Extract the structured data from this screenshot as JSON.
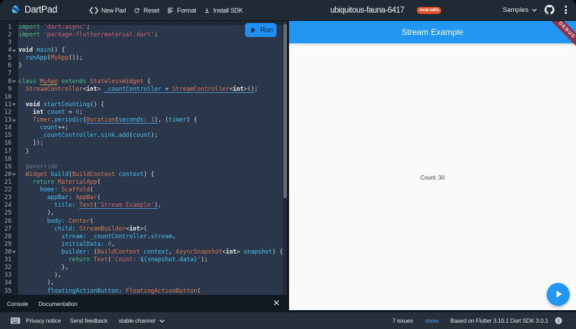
{
  "header": {
    "brand": "DartPad",
    "menu": [
      {
        "icon": "code-icon",
        "label": "New Pad"
      },
      {
        "icon": "refresh-icon",
        "label": "Reset"
      },
      {
        "icon": "format-icon",
        "label": "Format"
      },
      {
        "icon": "download-icon",
        "label": "Install SDK"
      }
    ],
    "pad_title": "ubiquitous-fauna-6417",
    "badge": "local edits",
    "samples": "Samples"
  },
  "editor": {
    "run_label": "Run",
    "fold_lines": [
      4,
      8,
      11,
      13,
      20,
      30
    ],
    "line_count": 35,
    "lines": [
      [
        [
          "k",
          "import"
        ],
        [
          "p",
          " "
        ],
        [
          "s",
          "'dart:async'"
        ],
        [
          "p",
          ";"
        ]
      ],
      [
        [
          "k",
          "import"
        ],
        [
          "p",
          " "
        ],
        [
          "s",
          "'package:flutter/material.dart'"
        ],
        [
          "p",
          ";"
        ]
      ],
      [],
      [
        [
          "b",
          "void"
        ],
        [
          "p",
          " "
        ],
        [
          "v",
          "main"
        ],
        [
          "p",
          "() {"
        ]
      ],
      [
        [
          "p",
          "  "
        ],
        [
          "v",
          "runApp"
        ],
        [
          "p",
          "("
        ],
        [
          "t",
          "MyApp"
        ],
        [
          "p",
          "());"
        ]
      ],
      [
        [
          "p",
          "}"
        ]
      ],
      [],
      [
        [
          "k",
          "class"
        ],
        [
          "p",
          " "
        ],
        [
          "t uk",
          "MyApp"
        ],
        [
          "p",
          " "
        ],
        [
          "k",
          "extends"
        ],
        [
          "p",
          " "
        ],
        [
          "t",
          "StatelessWidget"
        ],
        [
          "p",
          " {"
        ]
      ],
      [
        [
          "p",
          "  "
        ],
        [
          "t",
          "StreamController"
        ],
        [
          "p",
          "<"
        ],
        [
          "b",
          "int"
        ],
        [
          "p",
          "> "
        ],
        [
          "v ub",
          "_countController"
        ],
        [
          "p ub",
          " = "
        ],
        [
          "t ub",
          "StreamController"
        ],
        [
          "p ub",
          "<"
        ],
        [
          "b ub",
          "int"
        ],
        [
          "p ub",
          ">()"
        ],
        [
          "p",
          ";"
        ]
      ],
      [],
      [
        [
          "p",
          "  "
        ],
        [
          "b",
          "void"
        ],
        [
          "p",
          " "
        ],
        [
          "v",
          "startCounting"
        ],
        [
          "p",
          "() {"
        ]
      ],
      [
        [
          "p",
          "    "
        ],
        [
          "b",
          "int"
        ],
        [
          "p",
          " "
        ],
        [
          "v",
          "count"
        ],
        [
          "p",
          " = "
        ],
        [
          "n",
          "0"
        ],
        [
          "p",
          ";"
        ]
      ],
      [
        [
          "p",
          "    "
        ],
        [
          "t",
          "Timer"
        ],
        [
          "p",
          "."
        ],
        [
          "v",
          "periodic"
        ],
        [
          "p",
          "("
        ],
        [
          "t ub",
          "Duration"
        ],
        [
          "p ub",
          "("
        ],
        [
          "v ub",
          "seconds:"
        ],
        [
          "p ub",
          " "
        ],
        [
          "n ub",
          "1"
        ],
        [
          "p ub",
          ")"
        ],
        [
          "p",
          ", ("
        ],
        [
          "v",
          "timer"
        ],
        [
          "p",
          ") {"
        ]
      ],
      [
        [
          "p",
          "      "
        ],
        [
          "v",
          "count"
        ],
        [
          "p",
          "++;"
        ]
      ],
      [
        [
          "p",
          "      "
        ],
        [
          "v",
          "_countController"
        ],
        [
          "p",
          "."
        ],
        [
          "v",
          "sink"
        ],
        [
          "p",
          "."
        ],
        [
          "v",
          "add"
        ],
        [
          "p",
          "("
        ],
        [
          "v",
          "count"
        ],
        [
          "p",
          ");"
        ]
      ],
      [
        [
          "p",
          "    });"
        ]
      ],
      [
        [
          "p",
          "  }"
        ]
      ],
      [],
      [
        [
          "c",
          "  @override"
        ]
      ],
      [
        [
          "p",
          "  "
        ],
        [
          "t",
          "Widget"
        ],
        [
          "p",
          " "
        ],
        [
          "v",
          "build"
        ],
        [
          "p",
          "("
        ],
        [
          "t",
          "BuildContext"
        ],
        [
          "p",
          " "
        ],
        [
          "v",
          "context"
        ],
        [
          "p",
          ") {"
        ]
      ],
      [
        [
          "p",
          "    "
        ],
        [
          "k",
          "return"
        ],
        [
          "p",
          " "
        ],
        [
          "t",
          "MaterialApp"
        ],
        [
          "p",
          "("
        ]
      ],
      [
        [
          "p",
          "      "
        ],
        [
          "v",
          "home:"
        ],
        [
          "p",
          " "
        ],
        [
          "t",
          "Scaffold"
        ],
        [
          "p",
          "("
        ]
      ],
      [
        [
          "p",
          "        "
        ],
        [
          "v",
          "appBar:"
        ],
        [
          "p",
          " "
        ],
        [
          "t",
          "AppBar"
        ],
        [
          "p",
          "("
        ]
      ],
      [
        [
          "p",
          "          "
        ],
        [
          "v",
          "title:"
        ],
        [
          "p",
          " "
        ],
        [
          "t ub",
          "Text"
        ],
        [
          "p ub",
          "("
        ],
        [
          "s ub",
          "'Stream Example'"
        ],
        [
          "p ub",
          ")"
        ],
        [
          "p",
          ","
        ]
      ],
      [
        [
          "p",
          "        ),"
        ]
      ],
      [
        [
          "p",
          "        "
        ],
        [
          "v",
          "body:"
        ],
        [
          "p",
          " "
        ],
        [
          "t",
          "Center"
        ],
        [
          "p",
          "("
        ]
      ],
      [
        [
          "p",
          "          "
        ],
        [
          "v",
          "child:"
        ],
        [
          "p",
          " "
        ],
        [
          "t",
          "StreamBuilder"
        ],
        [
          "p",
          "<"
        ],
        [
          "b",
          "int"
        ],
        [
          "p",
          ">("
        ]
      ],
      [
        [
          "p",
          "            "
        ],
        [
          "v",
          "stream:"
        ],
        [
          "p",
          " "
        ],
        [
          "v",
          "_countController"
        ],
        [
          "p",
          "."
        ],
        [
          "v",
          "stream"
        ],
        [
          "p",
          ","
        ]
      ],
      [
        [
          "p",
          "            "
        ],
        [
          "v",
          "initialData:"
        ],
        [
          "p",
          " "
        ],
        [
          "n",
          "0"
        ],
        [
          "p",
          ","
        ]
      ],
      [
        [
          "p",
          "            "
        ],
        [
          "v",
          "builder:"
        ],
        [
          "p",
          " ("
        ],
        [
          "t",
          "BuildContext"
        ],
        [
          "p",
          " "
        ],
        [
          "v",
          "context"
        ],
        [
          "p",
          ", "
        ],
        [
          "t",
          "AsyncSnapshot"
        ],
        [
          "p",
          "<"
        ],
        [
          "b",
          "int"
        ],
        [
          "p",
          "> "
        ],
        [
          "v",
          "snapshot"
        ],
        [
          "p",
          ") {"
        ]
      ],
      [
        [
          "p",
          "              "
        ],
        [
          "k",
          "return"
        ],
        [
          "p",
          " "
        ],
        [
          "t",
          "Text"
        ],
        [
          "p",
          "("
        ],
        [
          "s",
          "'Count: "
        ],
        [
          "v",
          "${snapshot.data}"
        ],
        [
          "s",
          "'"
        ],
        [
          "p",
          ");"
        ]
      ],
      [
        [
          "p",
          "            },"
        ]
      ],
      [
        [
          "p",
          "          ),"
        ]
      ],
      [
        [
          "p",
          "        ),"
        ]
      ],
      [
        [
          "p",
          "        "
        ],
        [
          "v",
          "floatingActionButton:"
        ],
        [
          "p",
          " "
        ],
        [
          "t",
          "FloatingActionButton"
        ],
        [
          "p",
          "("
        ]
      ]
    ]
  },
  "console": {
    "tabs": [
      "Console",
      "Documentation"
    ],
    "close": "×"
  },
  "preview": {
    "appbar_title": "Stream Example",
    "body_text": "Count: 30",
    "debug_label": "DEBUG"
  },
  "footer": {
    "privacy": "Privacy notice",
    "feedback": "Send feedback",
    "channel": "stable channel",
    "issues": "7 issues",
    "show": "show",
    "based_on": "Based on Flutter 3.10.1 Dart SDK 3.0.1"
  },
  "colors": {
    "accent_blue": "#2196f3",
    "badge_orange": "#e5512c",
    "debug_banner": "#8e3145",
    "header_bg": "#1f2a35",
    "editor_bg": "#2a364a"
  }
}
